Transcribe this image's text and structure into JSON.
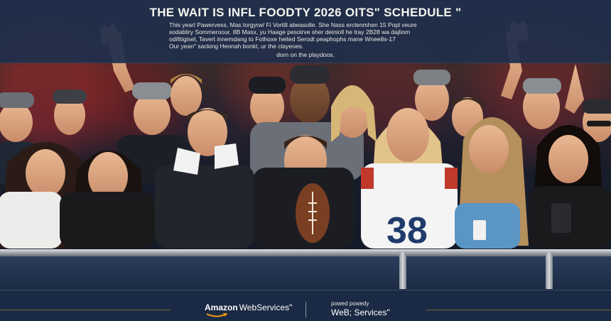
{
  "banner": {
    "headline": "THE WAIT IS INFL FOODTY 2026 OITS\" SCHEDULE \"",
    "subtitle_lines": [
      "This yearl Pawervess, Mas torgyrw/ Fi Vortill abeasolle. She Nass erclenmhen 15 Popl veure",
      "sodabliry Sommeroour. 8B Masx, yu Haage pesoirve sher deinioll he tray 2B28 wa dajliom",
      "odifitigisel, Tavert innemdang to Fothoxe heited Serodt peaphophs mane Wnee8s-17",
      "Our yean\" sacking Heonah bonkt, ur the clayeoes.",
      "dorn on the playdoos."
    ]
  },
  "colors": {
    "banner_bg": "#212f4a",
    "barrier_bg": "#1c2b44",
    "footer_bg": "#1a2a44",
    "text_light": "#f5f5f0",
    "aws_orange": "#f39c12",
    "jersey_red": "#c0392b",
    "jersey_navy": "#1f3a6b"
  },
  "scene": {
    "description_icons": [
      "crowd-photo",
      "football-icon",
      "foam-finger-icon",
      "phone-icon",
      "aws-smile-logo"
    ]
  },
  "footer": {
    "aws_logo": {
      "amazon": "Amazon",
      "web_services": "WebServices\""
    },
    "powered_by": "powed powedy",
    "powered_services": "WeB; Services\""
  }
}
